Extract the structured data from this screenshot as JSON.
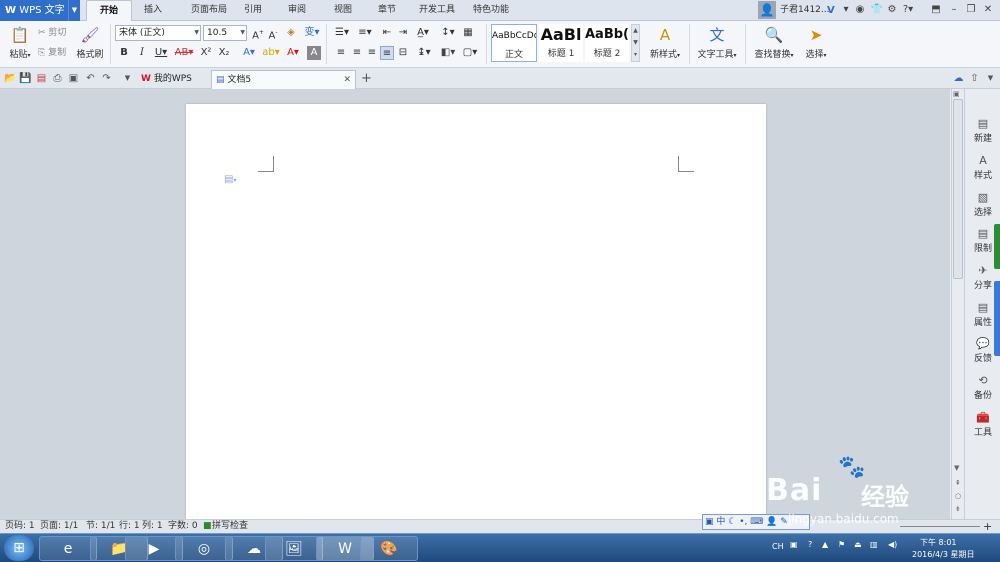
{
  "app": {
    "name": "WPS 文字"
  },
  "menu": {
    "tabs": [
      "开始",
      "插入",
      "页面布局",
      "引用",
      "审阅",
      "视图",
      "章节",
      "开发工具",
      "特色功能"
    ],
    "active": "开始"
  },
  "user": {
    "name": "子君1412..."
  },
  "ribbon": {
    "paste": "粘贴",
    "cut": "剪切",
    "copy": "复制",
    "format_painter": "格式刷",
    "font_name": "宋体 (正文)",
    "font_size": "10.5",
    "styles": [
      {
        "preview": "AaBbCcDd",
        "name": "正文"
      },
      {
        "preview": "AaBl",
        "name": "标题 1"
      },
      {
        "preview": "AaBb(",
        "name": "标题 2"
      }
    ],
    "new_style": "新样式",
    "text_tools": "文字工具",
    "find_replace": "查找替换",
    "select": "选择"
  },
  "quick_tabs": [
    {
      "label": "我的WPS"
    },
    {
      "label": "文档5"
    }
  ],
  "right_panel": [
    "新建",
    "样式",
    "选择",
    "限制",
    "分享",
    "属性",
    "反馈",
    "备份",
    "工具"
  ],
  "status": {
    "page_no": "页码: 1",
    "pages": "页面: 1/1",
    "section": "节: 1/1",
    "row": "行: 1",
    "col": "列: 1",
    "words": "字数: 0",
    "spell": "拼写检查"
  },
  "ime": {
    "mode": "中"
  },
  "tray": {
    "lang": "CH",
    "time": "下午 8:01",
    "date": "2016/4/3 星期日"
  },
  "watermark": {
    "brand": "Bai",
    "brand2": "经验",
    "url": "jingyan.baidu.com"
  }
}
